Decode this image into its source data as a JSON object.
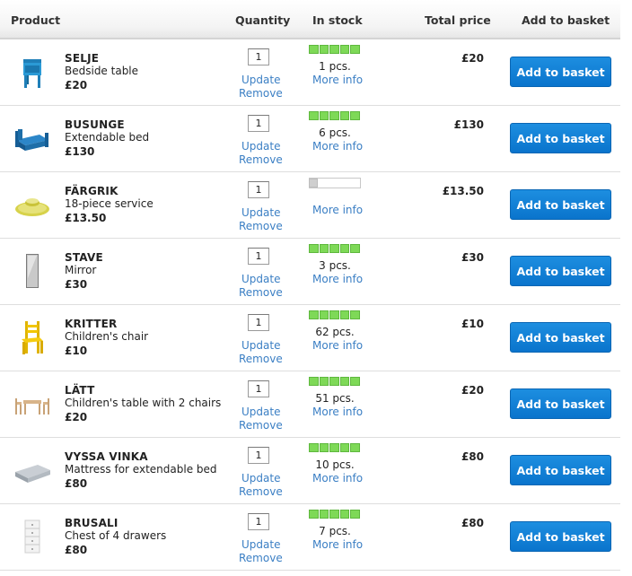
{
  "headers": {
    "product": "Product",
    "quantity": "Quantity",
    "in_stock": "In stock",
    "total_price": "Total price",
    "add_to_basket": "Add to basket"
  },
  "labels": {
    "update": "Update",
    "remove": "Remove",
    "more_info": "More info",
    "add_button": "Add to basket"
  },
  "colors": {
    "stock_green": "#7ed957",
    "link_blue": "#3b7fc4",
    "button_blue": "#0a74cc"
  },
  "rows": [
    {
      "name": "SELJE",
      "description": "Bedside table",
      "price": "£20",
      "quantity": "1",
      "stock_level": 1.0,
      "stock_text": "1 pcs.",
      "total": "£20",
      "icon": "bedside-table-icon"
    },
    {
      "name": "BUSUNGE",
      "description": "Extendable bed",
      "price": "£130",
      "quantity": "1",
      "stock_level": 1.0,
      "stock_text": "6 pcs.",
      "total": "£130",
      "icon": "extendable-bed-icon"
    },
    {
      "name": "FÄRGRIK",
      "description": "18-piece service",
      "price": "£13.50",
      "quantity": "1",
      "stock_level": 0.2,
      "stock_text": "",
      "total": "£13.50",
      "icon": "dinner-service-icon"
    },
    {
      "name": "STAVE",
      "description": "Mirror",
      "price": "£30",
      "quantity": "1",
      "stock_level": 1.0,
      "stock_text": "3 pcs.",
      "total": "£30",
      "icon": "mirror-icon"
    },
    {
      "name": "KRITTER",
      "description": "Children's chair",
      "price": "£10",
      "quantity": "1",
      "stock_level": 1.0,
      "stock_text": "62 pcs.",
      "total": "£10",
      "icon": "childrens-chair-icon"
    },
    {
      "name": "LÄTT",
      "description": "Children's table with 2 chairs",
      "price": "£20",
      "quantity": "1",
      "stock_level": 1.0,
      "stock_text": "51 pcs.",
      "total": "£20",
      "icon": "childrens-table-icon"
    },
    {
      "name": "VYSSA VINKA",
      "description": "Mattress for extendable bed",
      "price": "£80",
      "quantity": "1",
      "stock_level": 1.0,
      "stock_text": "10 pcs.",
      "total": "£80",
      "icon": "mattress-icon"
    },
    {
      "name": "BRUSALI",
      "description": "Chest of 4 drawers",
      "price": "£80",
      "quantity": "1",
      "stock_level": 1.0,
      "stock_text": "7 pcs.",
      "total": "£80",
      "icon": "chest-of-drawers-icon"
    }
  ]
}
